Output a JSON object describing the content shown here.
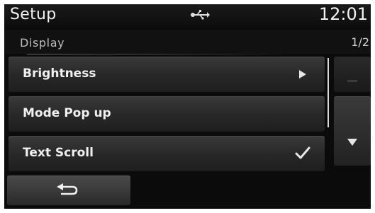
{
  "header": {
    "title": "Setup",
    "clock": "12:01",
    "usb_icon": "usb-icon"
  },
  "sub_header": {
    "section": "Display",
    "page_indicator": "1/2"
  },
  "list": {
    "items": [
      {
        "label": "Brightness",
        "accessory": "arrow-right-icon"
      },
      {
        "label": "Mode Pop up",
        "accessory": ""
      },
      {
        "label": "Text Scroll",
        "accessory": "checkmark-icon",
        "checked": true
      }
    ]
  },
  "scroll": {
    "up_icon": "scroll-up-icon",
    "down_icon": "scroll-down-icon"
  },
  "footer": {
    "back_icon": "back-arrow-icon"
  },
  "colors": {
    "background": "#0b0b0b",
    "text": "#f0f0f0",
    "row": "#2a2a2a"
  }
}
